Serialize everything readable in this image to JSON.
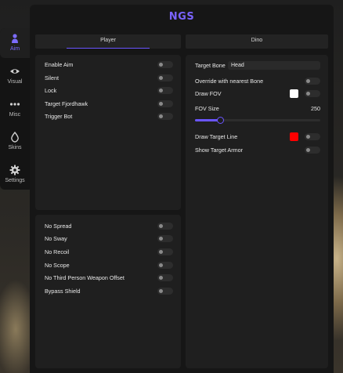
{
  "app": {
    "logo": "NGS",
    "accent": "#6a55ff"
  },
  "sidebar": {
    "items": [
      {
        "label": "Aim",
        "icon": "person-icon",
        "active": true
      },
      {
        "label": "Visual",
        "icon": "eye-icon",
        "active": false
      },
      {
        "label": "Misc",
        "icon": "dots-icon",
        "active": false
      },
      {
        "label": "Skins",
        "icon": "drop-icon",
        "active": false
      },
      {
        "label": "Settings",
        "icon": "gear-icon",
        "active": false
      }
    ]
  },
  "tabs": [
    {
      "label": "Player",
      "active": true
    },
    {
      "label": "Dino",
      "active": false
    }
  ],
  "aim_panel": {
    "items": [
      {
        "label": "Enable Aim",
        "enabled": false
      },
      {
        "label": "Silent",
        "enabled": false
      },
      {
        "label": "Lock",
        "enabled": false
      },
      {
        "label": "Target Fjordhawk",
        "enabled": false
      },
      {
        "label": "Trigger Bot",
        "enabled": false
      }
    ]
  },
  "weapon_panel": {
    "items": [
      {
        "label": "No Spread",
        "enabled": false
      },
      {
        "label": "No Sway",
        "enabled": false
      },
      {
        "label": "No Recoil",
        "enabled": false
      },
      {
        "label": "No Scope",
        "enabled": false
      },
      {
        "label": "No Third Person Weapon Offset",
        "enabled": false
      },
      {
        "label": "Bypass Shield",
        "enabled": false
      }
    ]
  },
  "dino_panel": {
    "target_bone_label": "Target Bone",
    "target_bone_value": "Head",
    "override_label": "Override with nearest Bone",
    "draw_fov_label": "Draw FOV",
    "draw_fov_color": "#ffffff",
    "fov_size_label": "FOV Size",
    "fov_size_value": "250",
    "draw_target_line_label": "Draw Target Line",
    "draw_target_line_color": "#ff0000",
    "show_target_armor_label": "Show Target Armor"
  }
}
